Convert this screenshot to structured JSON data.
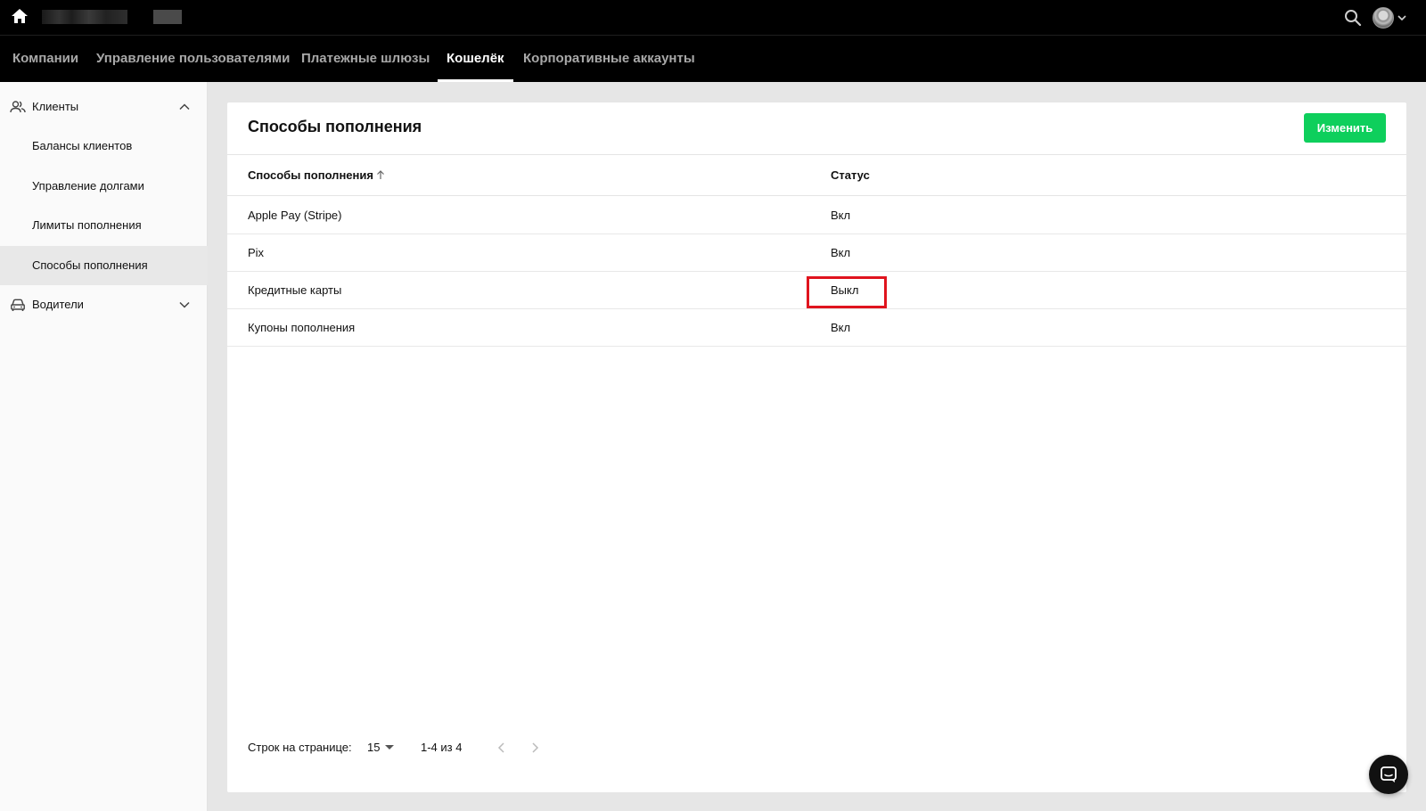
{
  "topbar": {
    "icons": {
      "home": "home-icon",
      "search": "search-icon",
      "avatar": "avatar",
      "menu": "chevron-down-icon"
    }
  },
  "nav": {
    "tabs": [
      {
        "label": "Компании",
        "active": false
      },
      {
        "label": "Управление пользователями",
        "active": false
      },
      {
        "label": "Платежные шлюзы",
        "active": false
      },
      {
        "label": "Кошелёк",
        "active": true
      },
      {
        "label": "Корпоративные аккаунты",
        "active": false
      }
    ]
  },
  "sidebar": {
    "groups": [
      {
        "label": "Клиенты",
        "icon": "users-icon",
        "expanded": true,
        "items": [
          {
            "label": "Балансы клиентов",
            "active": false
          },
          {
            "label": "Управление долгами",
            "active": false
          },
          {
            "label": "Лимиты пополнения",
            "active": false
          },
          {
            "label": "Способы пополнения",
            "active": true
          }
        ]
      },
      {
        "label": "Водители",
        "icon": "car-icon",
        "expanded": false,
        "items": []
      }
    ]
  },
  "main": {
    "title": "Способы пополнения",
    "edit_button": "Изменить",
    "table": {
      "columns": [
        "Способы пополнения",
        "Статус"
      ],
      "sort": "ascending",
      "rows": [
        {
          "method": "Apple Pay (Stripe)",
          "status": "Вкл"
        },
        {
          "method": "Pix",
          "status": "Вкл"
        },
        {
          "method": "Кредитные карты",
          "status": "Выкл",
          "highlighted": true
        },
        {
          "method": "Купоны пополнения",
          "status": "Вкл"
        }
      ]
    },
    "pagination": {
      "rows_per_page_label": "Строк на странице:",
      "rows_per_page": "15",
      "range": "1-4 из 4"
    }
  },
  "colors": {
    "accent_green": "#0ecf5c",
    "highlight_red": "#e0141e",
    "header_bg": "#000000"
  },
  "chat": {
    "icon": "chat-icon"
  }
}
